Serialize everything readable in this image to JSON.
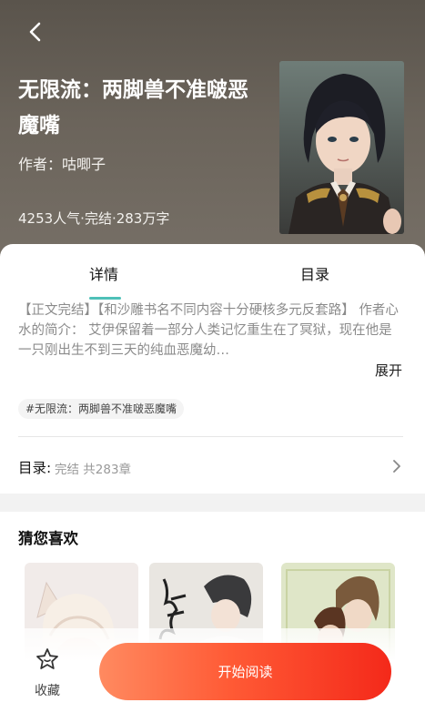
{
  "book": {
    "title": "无限流：两脚兽不准啵恶魔嘴",
    "author": "作者：咕唧子",
    "stats": "4253人气·完结·283万字"
  },
  "tabs": [
    {
      "label": "详情",
      "active": true
    },
    {
      "label": "目录",
      "active": false
    }
  ],
  "detail": {
    "synopsis": "【正文完结】【和沙雕书名不同内容十分硬核多元反套路】 作者心水的简介： 艾伊保留着一部分人类记忆重生在了冥狱，现在他是一只刚出生不到三天的纯血恶魔幼…",
    "expand_label": "展开",
    "tag": "#无限流：两脚兽不准啵恶魔嘴"
  },
  "toc": {
    "label": "目录:",
    "info": "完结 共283章"
  },
  "recommend": {
    "title": "猜您喜欢"
  },
  "bottom": {
    "favorite_label": "收藏",
    "read_label": "开始阅读"
  },
  "colors": {
    "header_bg": "#6b645b",
    "tab_accent": "#4ec0b8",
    "read_button_start": "#ff8a60",
    "read_button_end": "#f4291a"
  },
  "icons": [
    "back-arrow-icon",
    "chevron-right-icon",
    "star-icon"
  ]
}
